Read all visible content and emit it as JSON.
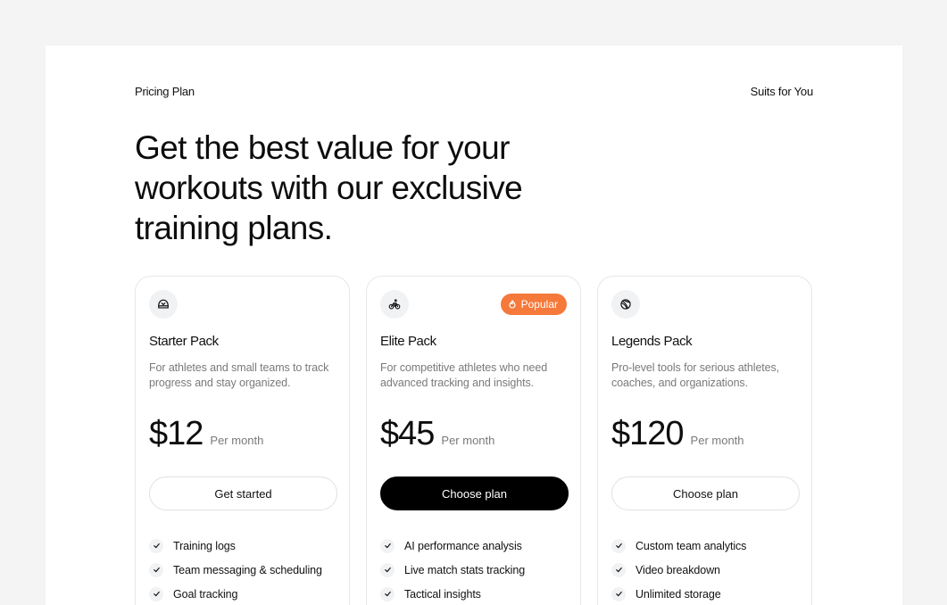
{
  "header": {
    "eyebrow_left": "Pricing Plan",
    "eyebrow_right": "Suits for You",
    "headline": "Get the best value for your workouts with our exclusive training plans."
  },
  "plans": [
    {
      "icon": "helmet-icon",
      "title": "Starter Pack",
      "description": "For athletes and small teams to track progress and stay organized.",
      "price": "$12",
      "period": "Per month",
      "cta": "Get started",
      "features": [
        "Training logs",
        "Team messaging & scheduling",
        "Goal tracking"
      ]
    },
    {
      "icon": "bicycle-icon",
      "badge": "Popular",
      "title": "Elite Pack",
      "description": "For competitive athletes who need advanced tracking and insights.",
      "price": "$45",
      "period": "Per month",
      "cta": "Choose plan",
      "features": [
        "AI performance analysis",
        "Live match stats tracking",
        "Tactical insights"
      ]
    },
    {
      "icon": "basketball-icon",
      "title": "Legends Pack",
      "description": "Pro-level tools for serious athletes, coaches, and organizations.",
      "price": "$120",
      "period": "Per month",
      "cta": "Choose plan",
      "features": [
        "Custom team analytics",
        "Video breakdown",
        "Unlimited storage"
      ]
    }
  ],
  "colors": {
    "background": "#f4f4f4",
    "panel": "#ffffff",
    "badge": "#f5793a",
    "primary_button": "#000000"
  }
}
